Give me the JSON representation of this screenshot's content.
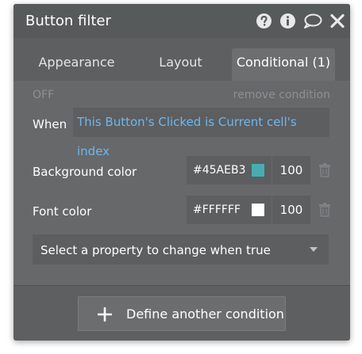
{
  "panel": {
    "title": "Button filter"
  },
  "tabs": [
    {
      "label": "Appearance",
      "active": false
    },
    {
      "label": "Layout",
      "active": false
    },
    {
      "label": "Conditional (1)",
      "active": true
    }
  ],
  "condition": {
    "status": "OFF",
    "remove_label": "remove condition",
    "when_label": "When",
    "expression": "This Button's Clicked is Current cell's index"
  },
  "properties": [
    {
      "label": "Background color",
      "hex": "#45AEB3",
      "swatch": "#45AEB3",
      "opacity": "100"
    },
    {
      "label": "Font color",
      "hex": "#FFFFFF",
      "swatch": "#FFFFFF",
      "opacity": "100"
    }
  ],
  "property_select": {
    "placeholder": "Select a property to change when true"
  },
  "define_button": {
    "label": "Define another condition"
  },
  "icons": {
    "header": [
      "help-icon",
      "info-icon",
      "comment-icon",
      "close-icon"
    ],
    "row_action": "trash-icon",
    "dropdown": "caret-down-icon",
    "add": "plus-icon"
  }
}
